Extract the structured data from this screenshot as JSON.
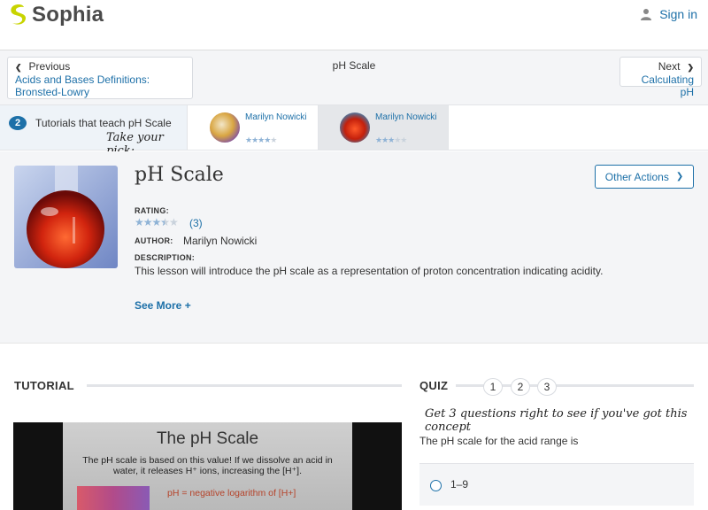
{
  "header": {
    "logo_text": "Sophia",
    "signin_label": "Sign in"
  },
  "nav": {
    "prev_label": "Previous",
    "prev_link": "Acids and Bases Definitions: Bronsted-Lowry",
    "title": "pH Scale",
    "next_label": "Next",
    "next_link": "Calculating pH"
  },
  "tutorials": {
    "count": "2",
    "label": "Tutorials that teach pH Scale",
    "pick": "Take your pick:",
    "cards": [
      {
        "author": "Marilyn Nowicki",
        "rating": 4,
        "selected": false
      },
      {
        "author": "Marilyn Nowicki",
        "rating": 3,
        "selected": true
      }
    ]
  },
  "lesson": {
    "title": "pH Scale",
    "other_actions": "Other Actions",
    "rating_label": "RATING:",
    "rating_value": 3.5,
    "rating_count": "(3)",
    "author_label": "AUTHOR:",
    "author": "Marilyn Nowicki",
    "description_label": "DESCRIPTION:",
    "description": "This lesson will introduce the pH scale as a representation of proton concentration indicating acidity.",
    "see_more": "See More +"
  },
  "tutorial_section": {
    "heading": "TUTORIAL",
    "slide_title": "The pH Scale",
    "slide_body": "The pH scale is based on this value! If we dissolve an acid in water, it releases H⁺ ions, increasing the [H⁺].",
    "slide_formula": "pH = negative logarithm of [H+]"
  },
  "quiz": {
    "heading": "QUIZ",
    "steps": [
      "1",
      "2",
      "3"
    ],
    "cta": "Get 3 questions right to see if you've got this concept",
    "question": "The pH scale for the acid range is",
    "options": [
      "1–9"
    ]
  },
  "colors": {
    "brand": "#1d70a8",
    "logo": "#c8d400"
  }
}
